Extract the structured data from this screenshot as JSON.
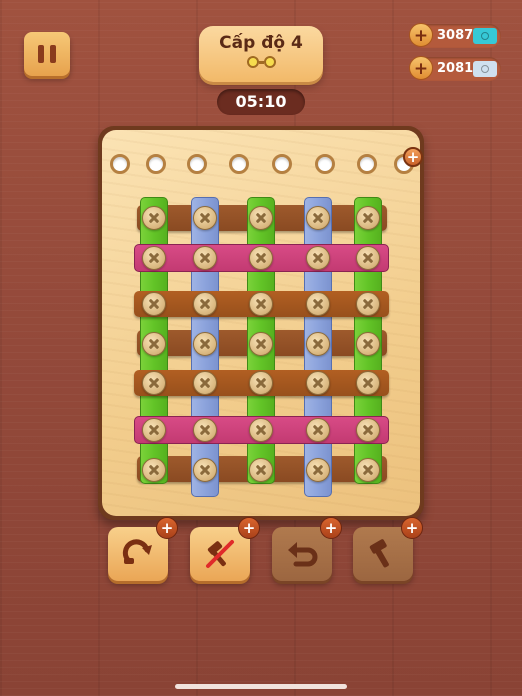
{
  "header": {
    "level_title": "Cấp độ 4",
    "timer": "05:10"
  },
  "currencies": [
    {
      "value": "3087",
      "ticket_color": "#36c9d6",
      "icon": "plus-icon"
    },
    {
      "value": "2081",
      "ticket_color": "#cfe0ef",
      "icon": "plus-icon"
    }
  ],
  "board": {
    "empty_holes": 8,
    "add_hole_icon": "plus-icon"
  },
  "boosters": [
    {
      "name": "rotate",
      "icon": "rotate-arrow-icon",
      "enabled": true
    },
    {
      "name": "remove-screw",
      "icon": "crossed-hammer-icon",
      "enabled": true
    },
    {
      "name": "undo",
      "icon": "undo-arrow-icon",
      "enabled": false
    },
    {
      "name": "hammer",
      "icon": "hammer-icon",
      "enabled": false
    }
  ],
  "colors": {
    "green": "#62c427",
    "blue": "#8ca3dc",
    "pink": "#cd427a",
    "brown": "#93501f",
    "board": "#f4d396"
  }
}
